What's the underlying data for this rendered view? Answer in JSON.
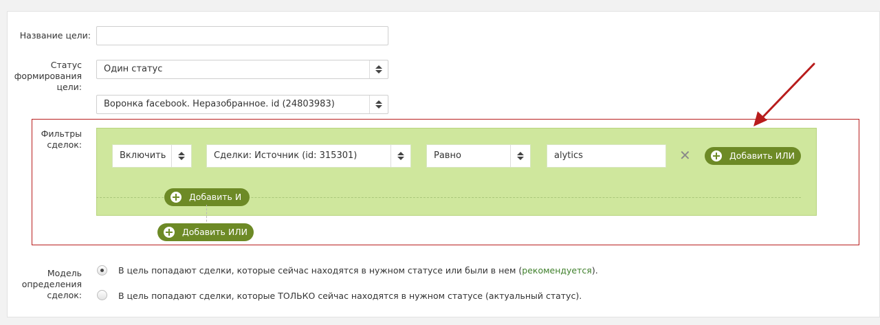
{
  "form": {
    "goal_name_label": "Название цели:",
    "goal_name_value": "",
    "status_label_line1": "Статус",
    "status_label_line2": "формирования",
    "status_label_line3": "цели:",
    "status_select": "Один статус",
    "pipeline_select": "Воронка facebook. Неразобранное. id (24803983)"
  },
  "filters": {
    "label_line1": "Фильтры",
    "label_line2": "сделок:",
    "include_select": "Включить",
    "field_select": "Сделки: Источник (id: 315301)",
    "operator_select": "Равно",
    "value_input": "alytics",
    "add_or_inner": "Добавить ИЛИ",
    "add_and": "Добавить И",
    "add_or_outer": "Добавить ИЛИ"
  },
  "model": {
    "label_line1": "Модель",
    "label_line2": "определения",
    "label_line3": "сделок:",
    "option1_text": "В цель попадают сделки, которые сейчас находятся в нужном статусе или были в нем (",
    "option1_rec": "рекомендуется",
    "option1_tail": ").",
    "option2_text": "В цель попадают сделки, которые ТОЛЬКО сейчас находятся в нужном статусе (актуальный статус).",
    "selected": 1
  },
  "colors": {
    "accent_green": "#6d8a26",
    "filter_bg": "#cfe79d",
    "highlight_red": "#b81c1c"
  }
}
